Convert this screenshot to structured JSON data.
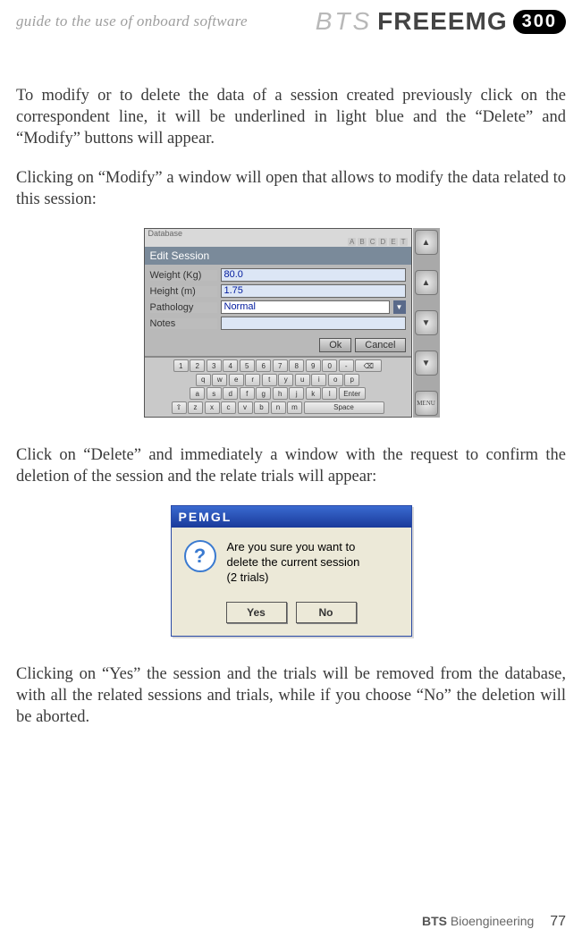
{
  "header": {
    "guide": "guide to the use of onboard software",
    "brand_bts": "BTS",
    "brand_freeemg": "FREEEMG",
    "brand_300": "300"
  },
  "paragraphs": {
    "p1": "To modify or to delete the data of a session created previously click on the correspondent line, it will be underlined in light blue and the “Delete” and “Modify” buttons will appear.",
    "p2": "Clicking on “Modify” a window will open that allows to modify the data related to this session:",
    "p3": "Click on “Delete” and immediately a window with the request to confirm the deletion of the session and the relate trials will appear:",
    "p4": "Clicking  on “Yes” the session and the trials will be removed from the database, with all the related sessions and trials, while if you choose “No” the deletion will be aborted."
  },
  "edit_dialog": {
    "database_label": "Database",
    "title": "Edit Session",
    "labels": {
      "weight": "Weight (Kg)",
      "height": "Height (m)",
      "pathology": "Pathology",
      "notes": "Notes"
    },
    "values": {
      "weight": "80.0",
      "height": "1.75",
      "pathology": "Normal",
      "notes": ""
    },
    "buttons": {
      "ok": "Ok",
      "cancel": "Cancel"
    },
    "side": {
      "menu": "MENU"
    },
    "keyboard": {
      "row1": [
        "1",
        "2",
        "3",
        "4",
        "5",
        "6",
        "7",
        "8",
        "9",
        "0",
        "-"
      ],
      "row2": [
        "q",
        "w",
        "e",
        "r",
        "t",
        "y",
        "u",
        "i",
        "o",
        "p"
      ],
      "row3": [
        "a",
        "s",
        "d",
        "f",
        "g",
        "h",
        "j",
        "k",
        "l"
      ],
      "row3_enter": "Enter",
      "row4": [
        "z",
        "x",
        "c",
        "v",
        "b",
        "n",
        "m"
      ],
      "row4_space": "Space"
    }
  },
  "confirm_dialog": {
    "title": "PEMGL",
    "message_l1": "Are you sure you want to",
    "message_l2": "delete the current session",
    "message_l3": "(2 trials)",
    "yes": "Yes",
    "no": "No"
  },
  "footer": {
    "company_bold": "BTS",
    "company_rest": " Bioengineering",
    "page": "77"
  }
}
